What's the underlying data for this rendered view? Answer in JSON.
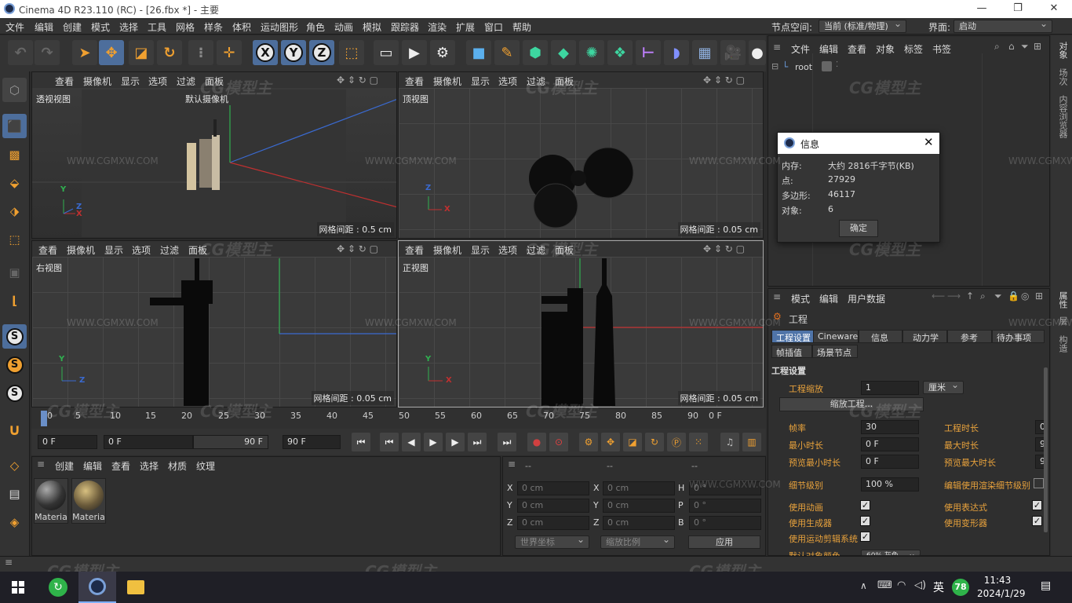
{
  "window": {
    "title": "Cinema 4D R23.110 (RC) - [26.fbx *] - 主要",
    "minimize": "—",
    "maximize": "❐",
    "close": "✕"
  },
  "menubar": {
    "items": [
      "文件",
      "编辑",
      "创建",
      "模式",
      "选择",
      "工具",
      "网格",
      "样条",
      "体积",
      "运动图形",
      "角色",
      "动画",
      "模拟",
      "跟踪器",
      "渲染",
      "扩展",
      "窗口",
      "帮助"
    ],
    "node_space_label": "节点空间:",
    "node_space_value": "当前 (标准/物理)",
    "layout_label": "界面:",
    "layout_value": "启动"
  },
  "viewports": {
    "menu": [
      "查看",
      "摄像机",
      "显示",
      "选项",
      "过滤",
      "面板"
    ],
    "perspective": {
      "name": "透视视图",
      "camera": "默认摄像机",
      "grid": "网格间距 : 0.5 cm"
    },
    "top": {
      "name": "顶视图",
      "grid": "网格间距 : 0.05 cm"
    },
    "right": {
      "name": "右视图",
      "grid": "网格间距 : 0.05 cm"
    },
    "front": {
      "name": "正视图",
      "grid": "网格间距 : 0.05 cm"
    }
  },
  "timeline": {
    "ticks": [
      "0",
      "5",
      "10",
      "15",
      "20",
      "25",
      "30",
      "35",
      "40",
      "45",
      "50",
      "55",
      "60",
      "65",
      "70",
      "75",
      "80",
      "85",
      "90"
    ],
    "current_frame": "0 F",
    "start": "0 F",
    "range_start": "0 F",
    "range_end": "90 F",
    "end": "90 F",
    "right_frame": "0 F"
  },
  "material_manager": {
    "menu": [
      "创建",
      "编辑",
      "查看",
      "选择",
      "材质",
      "纹理"
    ],
    "materials": [
      "Materia",
      "Materia"
    ]
  },
  "coord_manager": {
    "headers": [
      "--",
      "--",
      "--"
    ],
    "rows": [
      {
        "a": "X",
        "av": "0 cm",
        "b": "X",
        "bv": "0 cm",
        "c": "H",
        "cv": "0 °"
      },
      {
        "a": "Y",
        "av": "0 cm",
        "b": "Y",
        "bv": "0 cm",
        "c": "P",
        "cv": "0 °"
      },
      {
        "a": "Z",
        "av": "0 cm",
        "b": "Z",
        "bv": "0 cm",
        "c": "B",
        "cv": "0 °"
      }
    ],
    "world": "世界坐标",
    "scale": "缩放比例",
    "apply": "应用"
  },
  "object_manager": {
    "menu": [
      "文件",
      "编辑",
      "查看",
      "对象",
      "标签",
      "书签"
    ],
    "root": "root"
  },
  "info_dialog": {
    "title": "信息",
    "rows": [
      {
        "label": "内存:",
        "value": "大约 2816千字节(KB)"
      },
      {
        "label": "点:",
        "value": "27929"
      },
      {
        "label": "多边形:",
        "value": "46117"
      },
      {
        "label": "对象:",
        "value": "6"
      }
    ],
    "ok": "确定"
  },
  "attribute_manager": {
    "menu": [
      "模式",
      "编辑",
      "用户数据"
    ],
    "object_name": "工程",
    "tabs_row1": [
      "工程设置",
      "Cineware",
      "信息",
      "动力学",
      "参考",
      "待办事项"
    ],
    "tabs_row2": [
      "帧插值",
      "场景节点"
    ],
    "section": "工程设置",
    "scale_label": "工程缩放",
    "scale_value": "1",
    "scale_unit": "厘米",
    "scale_button": "缩放工程...",
    "fields_left": [
      {
        "label": "帧率",
        "value": "30"
      },
      {
        "label": "最小时长",
        "value": "0 F"
      },
      {
        "label": "预览最小时长",
        "value": "0 F"
      }
    ],
    "fields_right": [
      {
        "label": "工程时长",
        "value": "0"
      },
      {
        "label": "最大时长",
        "value": "9"
      },
      {
        "label": "预览最大时长",
        "value": "9"
      }
    ],
    "lod_label": "细节级别",
    "lod_value": "100 %",
    "lod_render_label": "编辑使用渲染细节级别",
    "checks_left": [
      "使用动画",
      "使用生成器",
      "使用运动剪辑系统"
    ],
    "checks_right": [
      "使用表达式",
      "使用变形器"
    ],
    "default_color_label": "默认对象颜色",
    "default_color_value": "60% 灰色"
  },
  "right_strip": {
    "top": [
      "对象",
      "场次",
      "内容浏览器"
    ],
    "bottom": [
      "属性",
      "层",
      "构造"
    ]
  },
  "watermark": {
    "text": "WWW.CGMXW.COM",
    "logo": "CG模型主"
  },
  "taskbar": {
    "time": "11:43",
    "date": "2024/1/29",
    "ime": "英",
    "badge": "78"
  }
}
